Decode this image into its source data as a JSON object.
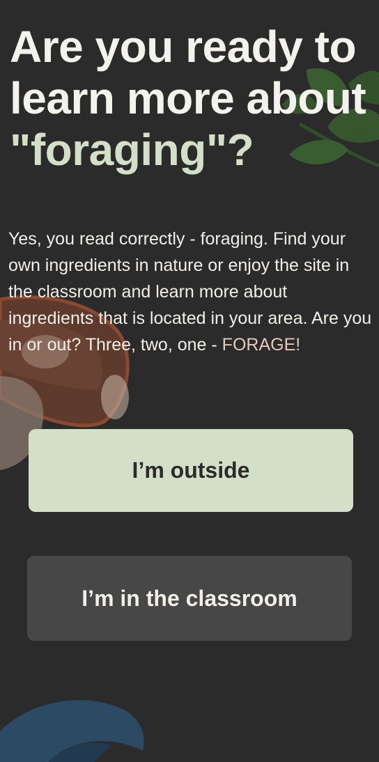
{
  "heading": {
    "line1": "Are you ready to",
    "line2": "learn more about",
    "highlight": "\"foraging\"?"
  },
  "intro": {
    "text": "Yes, you read correctly - foraging. Find your own ingredients in nature or enjoy the site in the classroom and learn more about ingredients that is located in your area. Are you in or out? Three, two, one -",
    "cta": "FORAGE!"
  },
  "buttons": {
    "outside_label": "I’m outside",
    "classroom_label": "I’m in the classroom"
  },
  "colors": {
    "background": "#2b2b2b",
    "accent_green": "#d3dfc6",
    "secondary_button": "#474747",
    "text_light": "#f2efe9",
    "cta_text": "#e8c9b9"
  },
  "icons": [
    "leaf-branch-icon",
    "mushroom-icon",
    "wave-icon"
  ]
}
